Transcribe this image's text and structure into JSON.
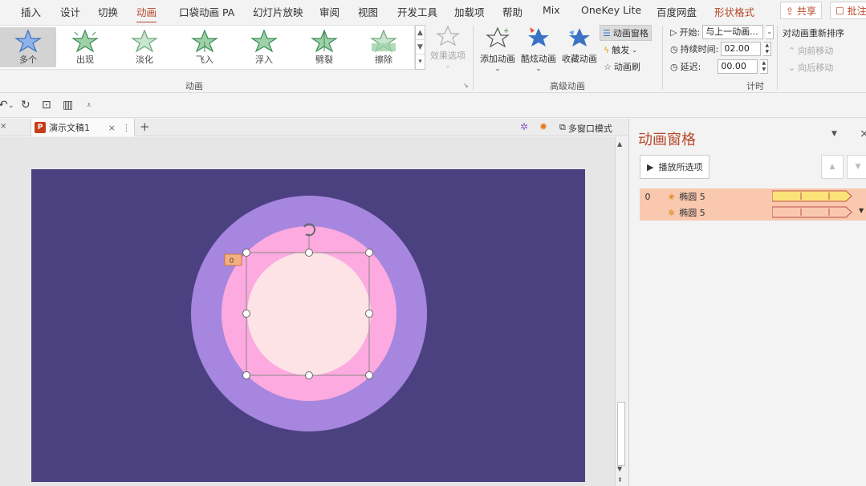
{
  "menu": {
    "items": [
      "插入",
      "设计",
      "切换",
      "动画",
      "口袋动画 PA",
      "幻灯片放映",
      "审阅",
      "视图",
      "开发工具",
      "加载项",
      "帮助",
      "Mix",
      "OneKey Lite",
      "百度网盘",
      "形状格式"
    ],
    "share_label": "共享",
    "comment_label": "批注"
  },
  "ribbon": {
    "animations": [
      "多个",
      "出现",
      "淡化",
      "飞入",
      "浮入",
      "劈裂",
      "擦除"
    ],
    "effect_options": "效果选项",
    "group_animation": "动画",
    "add_animation": "添加动画",
    "cool_animation": "酷炫动画",
    "fav_animation": "收藏动画",
    "anim_pane": "动画窗格",
    "trigger": "触发",
    "anim_painter": "动画刷",
    "group_advanced": "高级动画",
    "start_label": "开始:",
    "start_value": "与上一动画...",
    "duration_label": "持续时间:",
    "duration_value": "02.00",
    "delay_label": "延迟:",
    "delay_value": "00.00",
    "group_timing": "计时",
    "reorder_title": "对动画重新排序",
    "move_earlier": "向前移动",
    "move_later": "向后移动"
  },
  "tabs": {
    "doc_name": "演示文稿1",
    "multi_window": "多窗口模式"
  },
  "slide": {
    "anim_tag": "0",
    "colors": {
      "bg": "#4b4180",
      "outer": "#a686de",
      "middle": "#fcaadf",
      "inner": "#fde3e6"
    }
  },
  "pane": {
    "title": "动画窗格",
    "play_all": "播放所选项",
    "rows": [
      {
        "index": "0",
        "name": "椭圆 5",
        "kind": "entrance",
        "bar_color": "#fbe37a"
      },
      {
        "index": "",
        "name": "椭圆 5",
        "kind": "exit",
        "bar_color": "#f9c8ae"
      }
    ]
  }
}
